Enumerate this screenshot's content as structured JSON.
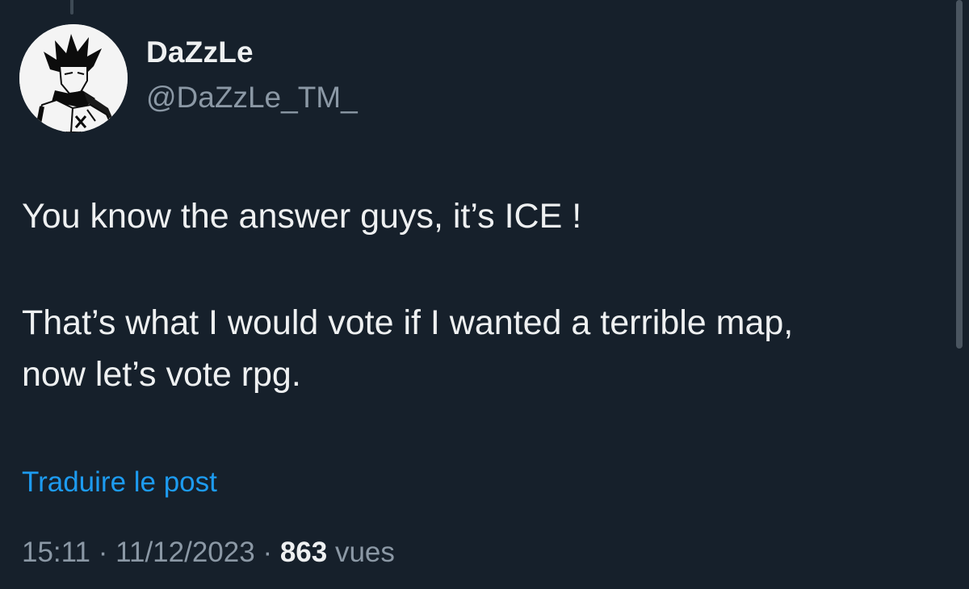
{
  "post": {
    "author": {
      "display_name": "DaZzLe",
      "handle": "@DaZzLe_TM_",
      "avatar_icon": "anime-character-avatar"
    },
    "text_lines": [
      "You know the answer guys, it’s ICE !",
      "That’s what I would vote if I wanted a terrible map,",
      "now let’s vote rpg."
    ],
    "translate_label": "Traduire le post",
    "meta": {
      "time": "15:11",
      "separator": "·",
      "date": "11/12/2023",
      "views_count": "863",
      "views_label": "vues"
    }
  },
  "colors": {
    "background": "#16202b",
    "primary_text": "#eef0f1",
    "secondary_text": "#8b98a5",
    "link": "#1d9bf0"
  }
}
